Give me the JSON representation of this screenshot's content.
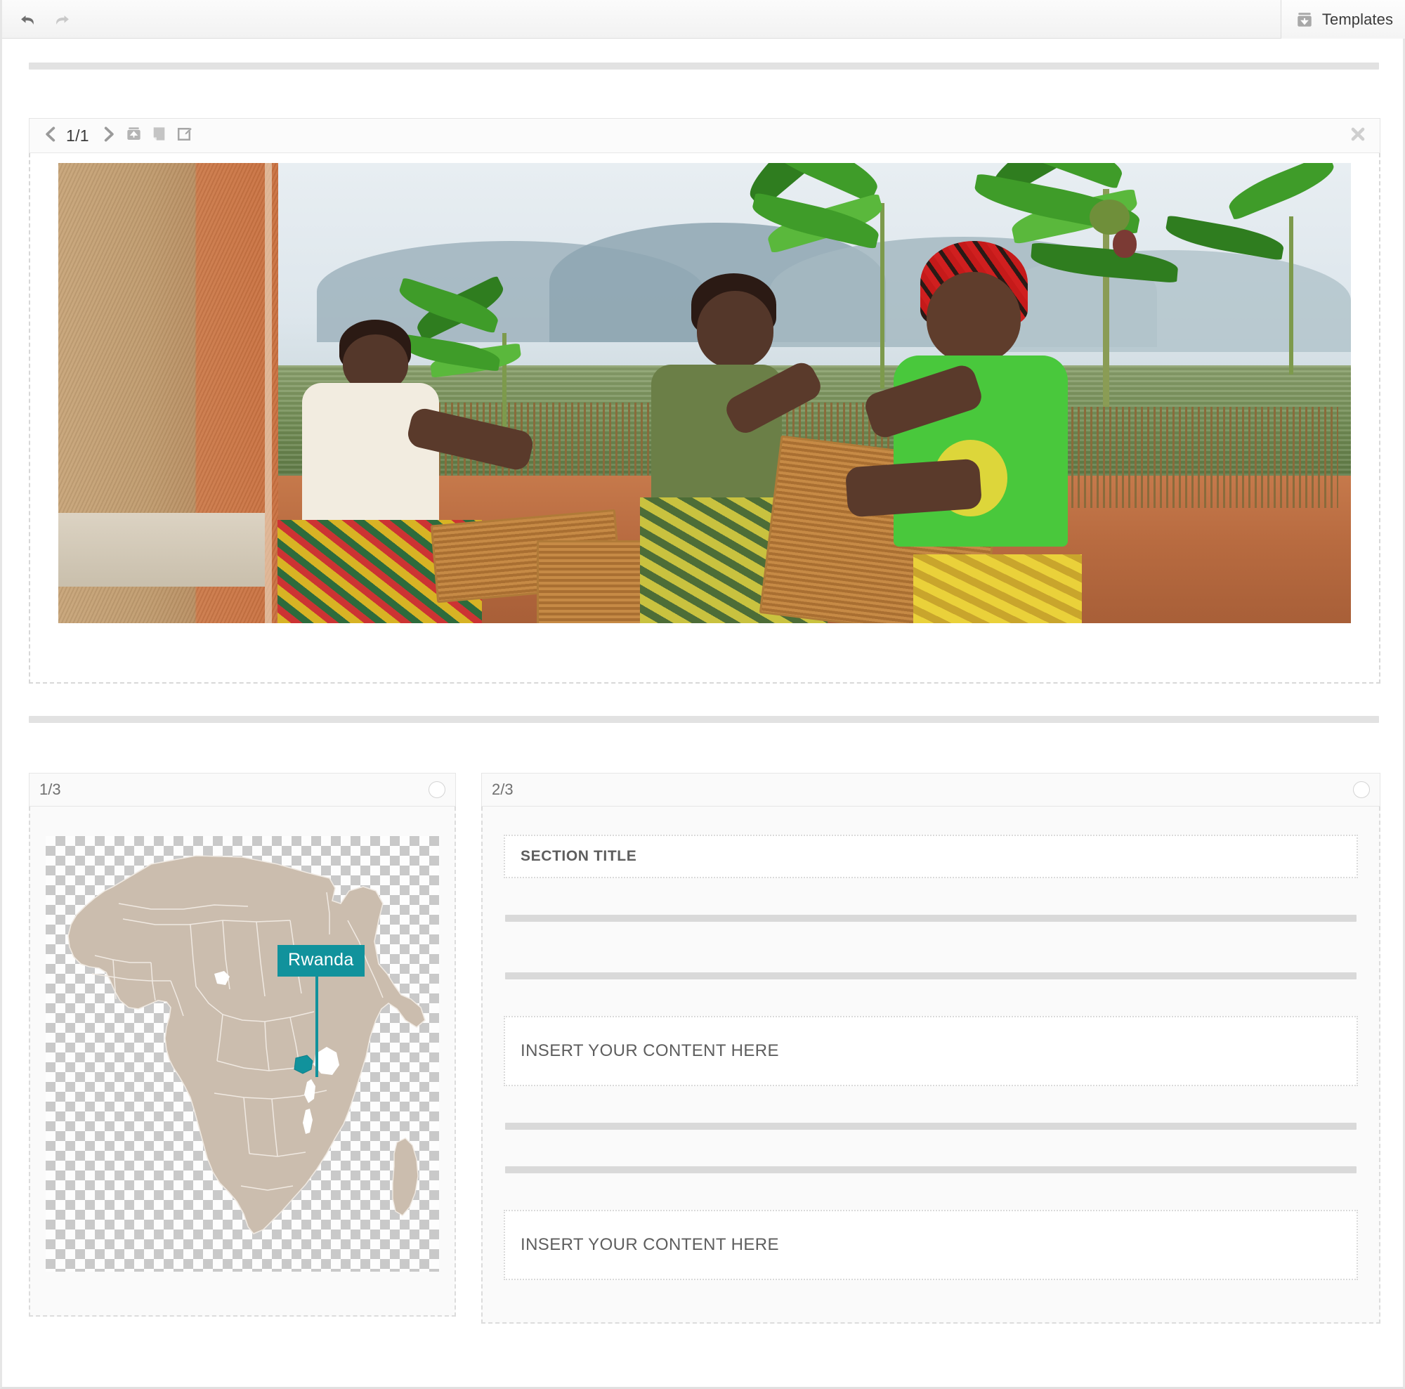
{
  "topbar": {
    "undo_icon": "undo-arrow-icon",
    "redo_icon": "redo-arrow-icon",
    "templates_label": "Templates",
    "templates_icon": "templates-box-icon"
  },
  "hero": {
    "page_indicator": "1/1",
    "prev_icon": "chevron-left-icon",
    "next_icon": "chevron-right-icon",
    "upload_icon": "upload-box-icon",
    "duplicate_icon": "duplicate-page-icon",
    "edit_icon": "edit-square-icon",
    "close_icon": "close-x-icon",
    "image_alt": "Three people weaving baskets outdoors in Rwanda"
  },
  "panels": [
    {
      "header_label": "1/3",
      "radio_icon": "empty-circle-icon",
      "map": {
        "region": "Africa",
        "callout_label": "Rwanda",
        "callout_color": "#11929c",
        "land_color": "#cbbdae"
      }
    },
    {
      "header_label": "2/3",
      "radio_icon": "empty-circle-icon",
      "blocks": [
        {
          "type": "title",
          "text": "SECTION TITLE"
        },
        {
          "type": "divider"
        },
        {
          "type": "divider"
        },
        {
          "type": "content",
          "text": "INSERT YOUR CONTENT HERE"
        },
        {
          "type": "divider"
        },
        {
          "type": "divider"
        },
        {
          "type": "content",
          "text": "INSERT YOUR CONTENT HERE"
        }
      ]
    }
  ],
  "colors": {
    "accent_teal": "#11929c",
    "toolbar_bg": "#f4f4f4",
    "panel_bg": "#fafafa",
    "divider_gray": "#d9d9d9",
    "text_gray": "#5e5e5e"
  }
}
